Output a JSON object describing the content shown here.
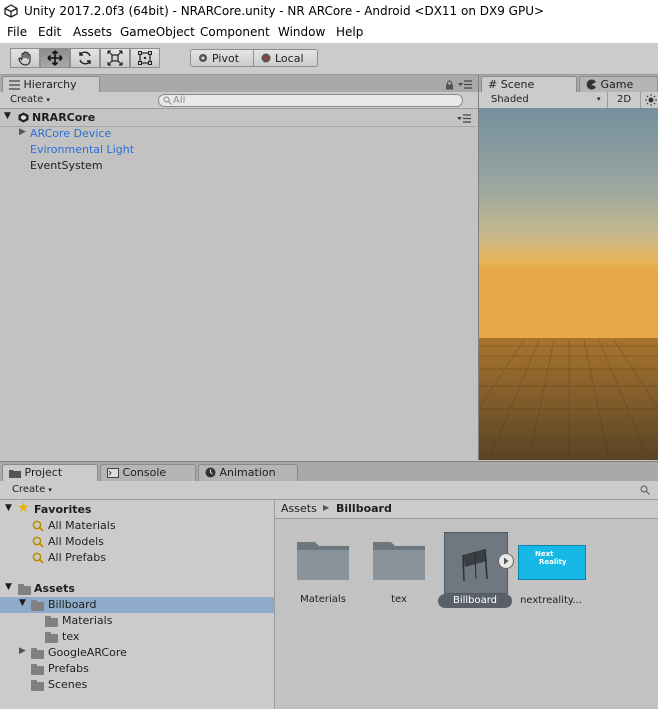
{
  "window": {
    "title": "Unity 2017.2.0f3 (64bit) - NRARCore.unity - NR ARCore - Android <DX11 on DX9 GPU>"
  },
  "menu": [
    "File",
    "Edit",
    "Assets",
    "GameObject",
    "Component",
    "Window",
    "Help"
  ],
  "toolbar": {
    "tools": [
      "hand-tool",
      "move-tool",
      "rotate-tool",
      "scale-tool",
      "rect-tool"
    ],
    "active_tool": "move-tool",
    "pivot_label": "Pivot",
    "local_label": "Local"
  },
  "hierarchy": {
    "tab_label": "Hierarchy",
    "create_label": "Create",
    "search_placeholder": "All",
    "scene_name": "NRARCore",
    "items": [
      {
        "label": "ARCore Device",
        "color": "#2d6fd6",
        "expandable": true
      },
      {
        "label": "Evironmental Light",
        "color": "#2d6fd6",
        "expandable": false
      },
      {
        "label": "EventSystem",
        "color": "#1e1e1e",
        "expandable": false
      }
    ]
  },
  "scene": {
    "tab_scene": "Scene",
    "tab_game": "Game",
    "shading_mode": "Shaded",
    "mode_2d": "2D"
  },
  "bottom_tabs": {
    "project": "Project",
    "console": "Console",
    "animation": "Animation"
  },
  "project": {
    "create_label": "Create",
    "favorites_label": "Favorites",
    "favorites": [
      "All Materials",
      "All Models",
      "All Prefabs"
    ],
    "assets_label": "Assets",
    "tree": [
      {
        "label": "Billboard",
        "level": 1,
        "selected": true,
        "expanded": true
      },
      {
        "label": "Materials",
        "level": 2,
        "selected": false,
        "expanded": false
      },
      {
        "label": "tex",
        "level": 2,
        "selected": false,
        "expanded": false
      },
      {
        "label": "GoogleARCore",
        "level": 1,
        "selected": false,
        "expanded": false,
        "expandable": true
      },
      {
        "label": "Prefabs",
        "level": 1,
        "selected": false,
        "expanded": false
      },
      {
        "label": "Scenes",
        "level": 1,
        "selected": false,
        "expanded": false
      }
    ],
    "breadcrumb": {
      "root": "Assets",
      "current": "Billboard"
    },
    "grid_items": [
      {
        "label": "Materials",
        "kind": "folder"
      },
      {
        "label": "tex",
        "kind": "folder"
      },
      {
        "label": "Billboard",
        "kind": "prefab",
        "selected": true
      },
      {
        "label": "nextreality...",
        "kind": "texture"
      }
    ],
    "thumbnail_text": {
      "line1": "Next",
      "line2": "Reality"
    }
  },
  "colors": {
    "accent_blue": "#2d6fd6",
    "selection": "#8eacc9",
    "texture_thumb": "#16b8e6"
  }
}
